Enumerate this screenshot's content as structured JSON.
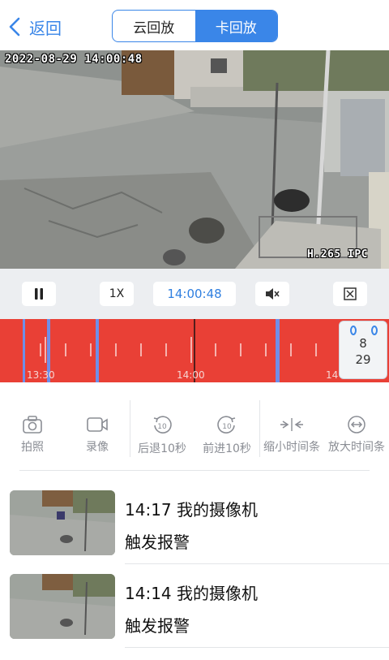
{
  "header": {
    "back_label": "返回",
    "tabs": [
      {
        "label": "云回放",
        "active": false
      },
      {
        "label": "卡回放",
        "active": true
      }
    ]
  },
  "video": {
    "osd_timestamp": "2022-08-29 14:00:48",
    "osd_codec": "H.265 IPC"
  },
  "controls": {
    "speed_label": "1X",
    "current_time": "14:00:48",
    "pause_icon": "pause-icon",
    "mute_icon": "mute-icon",
    "fullscreen_icon": "fullscreen-icon"
  },
  "timeline": {
    "labels": [
      "13:30",
      "14:00",
      "14"
    ],
    "date_month": "8",
    "date_day": "29",
    "colors": {
      "recording": "#e94036",
      "event_marker": "#6f8ee8"
    }
  },
  "tools": [
    {
      "label": "拍照",
      "icon": "camera-icon"
    },
    {
      "label": "录像",
      "icon": "video-record-icon"
    },
    {
      "label": "后退10秒",
      "icon": "rewind-10-icon"
    },
    {
      "label": "前进10秒",
      "icon": "forward-10-icon"
    },
    {
      "label": "缩小时间条",
      "icon": "shrink-timeline-icon"
    },
    {
      "label": "放大时间条",
      "icon": "expand-timeline-icon"
    }
  ],
  "alarms": [
    {
      "title": "14:17 我的摄像机",
      "type": "触发报警"
    },
    {
      "title": "14:14 我的摄像机",
      "type": "触发报警"
    }
  ],
  "colors": {
    "accent": "#3a86e8"
  }
}
